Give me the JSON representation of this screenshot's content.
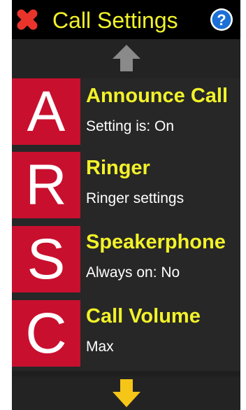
{
  "header": {
    "title": "Call Settings",
    "close_icon": "close-icon",
    "help_icon": "help-icon",
    "help_glyph": "?"
  },
  "scroll": {
    "up_icon": "arrow-up-icon",
    "down_icon": "arrow-down-icon"
  },
  "items": [
    {
      "letter": "A",
      "title": "Announce Call",
      "subtitle": "Setting is: On"
    },
    {
      "letter": "R",
      "title": "Ringer",
      "subtitle": "Ringer settings"
    },
    {
      "letter": "S",
      "title": "Speakerphone",
      "subtitle": "Always on: No"
    },
    {
      "letter": "C",
      "title": "Call Volume",
      "subtitle": "Max"
    }
  ],
  "colors": {
    "background": "#1f1f1f",
    "header_bg": "#000000",
    "accent_yellow": "#f2f22a",
    "tile_red": "#c8102e",
    "close_red": "#e8342b",
    "help_blue": "#1b6fd6",
    "arrow_up_gray": "#8a8a8a",
    "arrow_down_yellow": "#f5c518"
  }
}
